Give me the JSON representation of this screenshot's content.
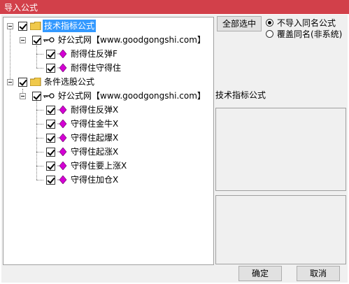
{
  "window": {
    "title": "导入公式"
  },
  "tree": {
    "items": [
      {
        "label": "技术指标公式",
        "kind": "folder",
        "checked": true,
        "selected": true
      },
      {
        "label": "好公式网【www.goodgongshi.com】",
        "kind": "key",
        "checked": true
      },
      {
        "label": "耐得住反弹F",
        "kind": "formula",
        "checked": true
      },
      {
        "label": "耐得住守得住",
        "kind": "formula",
        "checked": true
      },
      {
        "label": "条件选股公式",
        "kind": "folder",
        "checked": true
      },
      {
        "label": "好公式网【www.goodgongshi.com】",
        "kind": "key",
        "checked": true
      },
      {
        "label": "耐得住反弹X",
        "kind": "formula",
        "checked": true
      },
      {
        "label": "守得住金牛X",
        "kind": "formula",
        "checked": true
      },
      {
        "label": "守得住起爆X",
        "kind": "formula",
        "checked": true
      },
      {
        "label": "守得住起涨X",
        "kind": "formula",
        "checked": true
      },
      {
        "label": "守得住要上涨X",
        "kind": "formula",
        "checked": true
      },
      {
        "label": "守得住加仓X",
        "kind": "formula",
        "checked": true
      }
    ]
  },
  "options": {
    "select_all_label": "全部选中",
    "radio_no_import": "不导入同名公式",
    "radio_overwrite": "覆盖同名(非系统)",
    "selected_radio": "no_import"
  },
  "info": {
    "category_label": "技术指标公式"
  },
  "buttons": {
    "ok": "确定",
    "cancel": "取消"
  },
  "colors": {
    "titlebar": "#d2404a",
    "selection": "#3399ff",
    "folder": "#f0c94b",
    "diamond": "#d400d4"
  }
}
